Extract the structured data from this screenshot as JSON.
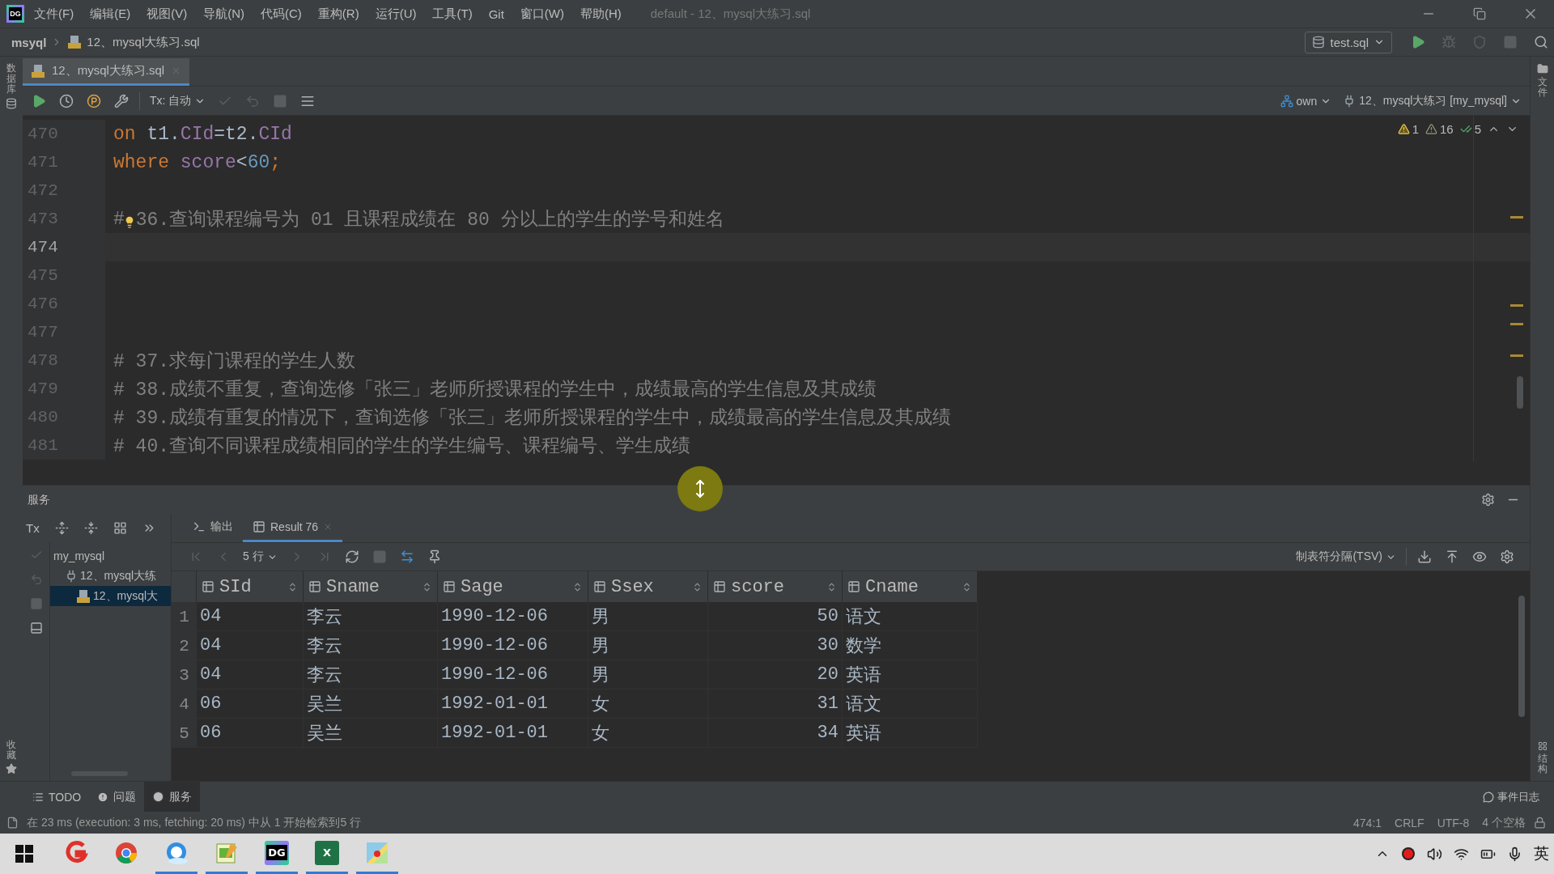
{
  "title_bar": {
    "logo": "DG",
    "menu": [
      "文件(F)",
      "编辑(E)",
      "视图(V)",
      "导航(N)",
      "代码(C)",
      "重构(R)",
      "运行(U)",
      "工具(T)",
      "Git",
      "窗口(W)",
      "帮助(H)"
    ],
    "title": "default - 12、mysql大练习.sql"
  },
  "nav_bar": {
    "project": "msyql",
    "file": "12、mysql大练习.sql",
    "run_config": "test.sql",
    "actions": [
      {
        "kind": "run",
        "disabled": false
      },
      {
        "kind": "debug",
        "disabled": true
      },
      {
        "kind": "coverage",
        "disabled": true
      },
      {
        "kind": "stop",
        "disabled": true
      },
      {
        "kind": "search",
        "disabled": false
      }
    ]
  },
  "left_strip": {
    "top": "数据库",
    "bottom": "收藏"
  },
  "right_strip": {
    "top": "文件",
    "bottom": "结构"
  },
  "editor": {
    "tabs": [
      {
        "label": "12、mysql大练习.sql",
        "selected": true
      }
    ],
    "left_actions": [
      {
        "kind": "run",
        "disabled": false
      },
      {
        "kind": "history",
        "disabled": false
      },
      {
        "kind": "profile",
        "disabled": false
      },
      {
        "kind": "wrench",
        "disabled": false
      }
    ],
    "tx_mode": "Tx: 自动",
    "right_actions": [
      {
        "kind": "commit",
        "disabled": true
      },
      {
        "kind": "rollback",
        "disabled": true
      },
      {
        "kind": "stop",
        "disabled": true
      },
      {
        "kind": "table",
        "disabled": false
      }
    ],
    "schema": "own",
    "console": "12、mysql大练习 [my_mysql]",
    "inspections": [
      {
        "kind": "warning",
        "count": "1"
      },
      {
        "kind": "weak",
        "count": "16"
      },
      {
        "kind": "ok",
        "count": "5"
      }
    ],
    "lines": [
      {
        "number": "470",
        "current": false,
        "tokens": [
          {
            "kind": "keyword",
            "text": "on"
          },
          {
            "kind": "ident",
            "text": " t1."
          },
          {
            "kind": "column",
            "text": "CId"
          },
          {
            "kind": "ident",
            "text": "=t2."
          },
          {
            "kind": "column",
            "text": "CId"
          }
        ]
      },
      {
        "number": "471",
        "current": false,
        "tokens": [
          {
            "kind": "keyword",
            "text": "where"
          },
          {
            "kind": "column",
            "text": " score"
          },
          {
            "kind": "ident",
            "text": "<"
          },
          {
            "kind": "number",
            "text": "60"
          },
          {
            "kind": "keyword",
            "text": ";"
          }
        ]
      },
      {
        "number": "472",
        "current": false
      },
      {
        "number": "473",
        "current": false,
        "tokens": [
          {
            "kind": "comment",
            "text": "#"
          },
          {
            "kind": "bulb"
          },
          {
            "kind": "comment",
            "text": "36.查询课程编号为 01 且课程成绩在 80 分以上的学生的学号和姓名"
          }
        ]
      },
      {
        "number": "474",
        "current": true
      },
      {
        "number": "475",
        "current": false
      },
      {
        "number": "476",
        "current": false
      },
      {
        "number": "477",
        "current": false
      },
      {
        "number": "478",
        "current": false,
        "tokens": [
          {
            "kind": "comment",
            "text": "# 37.求每门课程的学生人数"
          }
        ]
      },
      {
        "number": "479",
        "current": false,
        "tokens": [
          {
            "kind": "comment",
            "text": "# 38.成绩不重复，查询选修「张三」老师所授课程的学生中，成绩最高的学生信息及其成绩"
          }
        ]
      },
      {
        "number": "480",
        "current": false,
        "tokens": [
          {
            "kind": "comment",
            "text": "# 39.成绩有重复的情况下，查询选修「张三」老师所授课程的学生中，成绩最高的学生信息及其成绩"
          }
        ]
      },
      {
        "number": "481",
        "current": false,
        "tokens": [
          {
            "kind": "comment",
            "text": "# 40.查询不同课程成绩相同的学生的学生编号、课程编号、学生成绩"
          }
        ]
      }
    ]
  },
  "services": {
    "title": "服务",
    "tx": "Tx",
    "tree_actions": [
      {
        "kind": "expand",
        "disabled": false
      },
      {
        "kind": "collapse",
        "disabled": false
      },
      {
        "kind": "group",
        "disabled": false
      },
      {
        "kind": "more",
        "disabled": false
      }
    ],
    "side_actions": [
      {
        "kind": "commit",
        "disabled": true
      },
      {
        "kind": "rollback",
        "disabled": true
      },
      {
        "kind": "stop",
        "disabled": true
      },
      {
        "kind": "layout",
        "disabled": false
      }
    ],
    "tree": [
      {
        "label": "my_mysql",
        "selected": false,
        "children": [
          {
            "label": "12、mysql大练",
            "kind": "session",
            "selected": false,
            "children": [
              {
                "label": "12、mysql大",
                "kind": "console",
                "selected": true
              }
            ]
          }
        ]
      }
    ],
    "tabs": [
      {
        "label": "输出",
        "kind": "output",
        "selected": false
      },
      {
        "label": "Result 76",
        "kind": "result",
        "selected": true
      }
    ],
    "nav_left": [
      {
        "kind": "first",
        "disabled": true
      },
      {
        "kind": "prev",
        "disabled": true
      }
    ],
    "page_size": "5 行",
    "nav_right": [
      {
        "kind": "next",
        "disabled": true
      },
      {
        "kind": "last",
        "disabled": true
      },
      {
        "kind": "refresh",
        "disabled": false
      },
      {
        "kind": "stop",
        "disabled": true
      },
      {
        "kind": "compare",
        "disabled": false
      },
      {
        "kind": "pin",
        "disabled": false
      }
    ],
    "export_format": "制表符分隔(TSV)",
    "export_actions": [
      {
        "kind": "download",
        "disabled": false
      },
      {
        "kind": "upload",
        "disabled": false
      },
      {
        "kind": "eye",
        "disabled": false
      },
      {
        "kind": "gear",
        "disabled": false
      }
    ],
    "table": {
      "columns": [
        {
          "label": "SId",
          "kind": "text"
        },
        {
          "label": "Sname",
          "kind": "text"
        },
        {
          "label": "Sage",
          "kind": "text"
        },
        {
          "label": "Ssex",
          "kind": "text"
        },
        {
          "label": "score",
          "kind": "number"
        },
        {
          "label": "Cname",
          "kind": "text"
        }
      ],
      "rows": [
        {
          "number": "1",
          "cells": [
            "04",
            "李云",
            "1990-12-06",
            "男",
            "50",
            "语文"
          ]
        },
        {
          "number": "2",
          "cells": [
            "04",
            "李云",
            "1990-12-06",
            "男",
            "30",
            "数学"
          ]
        },
        {
          "number": "3",
          "cells": [
            "04",
            "李云",
            "1990-12-06",
            "男",
            "20",
            "英语"
          ]
        },
        {
          "number": "4",
          "cells": [
            "06",
            "吴兰",
            "1992-01-01",
            "女",
            "31",
            "语文"
          ]
        },
        {
          "number": "5",
          "cells": [
            "06",
            "吴兰",
            "1992-01-01",
            "女",
            "34",
            "英语"
          ]
        }
      ]
    }
  },
  "tool_windows": [
    {
      "label": "TODO",
      "kind": "todo",
      "selected": false
    },
    {
      "label": "问题",
      "kind": "problems",
      "selected": false
    },
    {
      "label": "服务",
      "kind": "services",
      "selected": true
    }
  ],
  "event_log": "事件日志",
  "status_bar": {
    "message": "在 23 ms (execution: 3 ms, fetching: 20 ms) 中从 1 开始检索到5 行",
    "items": [
      "474:1",
      "CRLF",
      "UTF-8",
      "4 个空格"
    ]
  },
  "taskbar": {
    "apps": [
      {
        "kind": "red-app",
        "running": false
      },
      {
        "kind": "chrome",
        "running": false
      },
      {
        "kind": "browser",
        "running": true
      },
      {
        "kind": "notepad",
        "running": true
      },
      {
        "kind": "datagrip",
        "label": "DG",
        "running": true
      },
      {
        "kind": "excel",
        "label": "X",
        "running": true
      },
      {
        "kind": "paint",
        "running": true
      }
    ],
    "ime": "英"
  }
}
